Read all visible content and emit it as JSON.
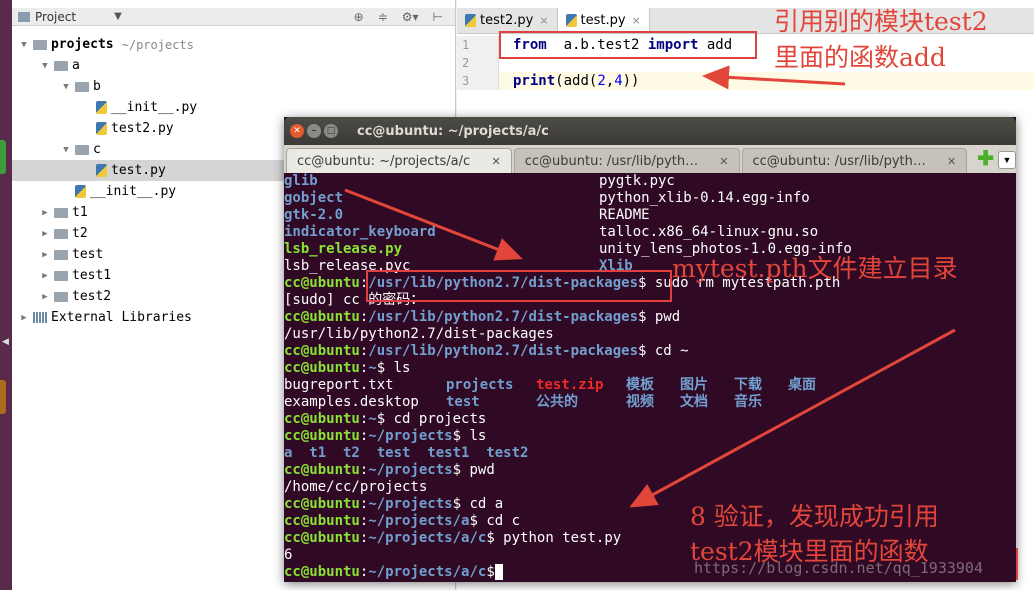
{
  "launcher": {},
  "project_panel": {
    "header": {
      "title": "Project",
      "tool_icons": [
        "crosshair-icon",
        "collapse-icon",
        "gear-icon",
        "hide-icon"
      ]
    },
    "tree": [
      {
        "label": "projects",
        "path": "~/projects",
        "depth": 0,
        "type": "folder",
        "expanded": true,
        "bold": true
      },
      {
        "label": "a",
        "depth": 1,
        "type": "folder",
        "expanded": true
      },
      {
        "label": "b",
        "depth": 2,
        "type": "folder",
        "expanded": true
      },
      {
        "label": "__init__.py",
        "depth": 3,
        "type": "py"
      },
      {
        "label": "test2.py",
        "depth": 3,
        "type": "py"
      },
      {
        "label": "c",
        "depth": 2,
        "type": "folder",
        "expanded": true
      },
      {
        "label": "test.py",
        "depth": 3,
        "type": "py",
        "selected": true
      },
      {
        "label": "__init__.py",
        "depth": 2,
        "type": "py"
      },
      {
        "label": "t1",
        "depth": 1,
        "type": "folder",
        "expanded": false
      },
      {
        "label": "t2",
        "depth": 1,
        "type": "folder",
        "expanded": false
      },
      {
        "label": "test",
        "depth": 1,
        "type": "folder",
        "expanded": false
      },
      {
        "label": "test1",
        "depth": 1,
        "type": "folder",
        "expanded": false
      },
      {
        "label": "test2",
        "depth": 1,
        "type": "folder",
        "expanded": false
      },
      {
        "label": "External Libraries",
        "depth": 0,
        "type": "lib",
        "expanded": false
      }
    ]
  },
  "editor": {
    "tabs": [
      {
        "label": "test2.py",
        "active": false
      },
      {
        "label": "test.py",
        "active": true
      }
    ],
    "lines": [
      {
        "no": "1",
        "parts": [
          [
            "kw",
            "from"
          ],
          [
            "",
            "  a.b.test2 "
          ],
          [
            "kw",
            "import"
          ],
          [
            "",
            " add"
          ]
        ]
      },
      {
        "no": "2",
        "parts": []
      },
      {
        "no": "3",
        "parts": [
          [
            "kw",
            "print"
          ],
          [
            "",
            "(add("
          ],
          [
            "num",
            "2"
          ],
          [
            "",
            ","
          ],
          [
            "num",
            "4"
          ],
          [
            "",
            "))"
          ]
        ]
      }
    ]
  },
  "annotations": {
    "top_line1": "引用别的模块test2",
    "top_line2": "里面的函数add",
    "mid": "mytest.pth文件建立目录",
    "bottom_line1": "8 验证，发现成功引用",
    "bottom_line2": "test2模块里面的函数"
  },
  "terminal": {
    "title": "cc@ubuntu: ~/projects/a/c",
    "tabs": [
      {
        "label": "cc@ubuntu: ~/projects/a/c",
        "active": true
      },
      {
        "label": "cc@ubuntu: /usr/lib/pyth…",
        "active": false
      },
      {
        "label": "cc@ubuntu: /usr/lib/pyth…",
        "active": false
      }
    ],
    "listing": [
      [
        [
          "dir",
          "glib"
        ],
        [
          "",
          "pygtk.pyc"
        ]
      ],
      [
        [
          "dir",
          "gobject"
        ],
        [
          "",
          "python_xlib-0.14.egg-info"
        ]
      ],
      [
        [
          "dir",
          "gtk-2.0"
        ],
        [
          "",
          "README"
        ]
      ],
      [
        [
          "dir",
          "indicator_keyboard"
        ],
        [
          "",
          "talloc.x86_64-linux-gnu.so"
        ]
      ],
      [
        [
          "exe",
          "lsb_release.py"
        ],
        [
          "",
          "unity_lens_photos-1.0.egg-info"
        ]
      ],
      [
        [
          "",
          "lsb_release.pyc"
        ],
        [
          "dir",
          "Xlib"
        ]
      ]
    ],
    "session": [
      {
        "user": "cc@ubuntu",
        "path": "/usr/lib/python2.7/dist-packages",
        "cmd": " sudo rm mytestpath.pth"
      },
      {
        "text": "[sudo] cc 的密码："
      },
      {
        "user": "cc@ubuntu",
        "path": "/usr/lib/python2.7/dist-packages",
        "cmd": " pwd"
      },
      {
        "text": "/usr/lib/python2.7/dist-packages"
      },
      {
        "user": "cc@ubuntu",
        "path": "/usr/lib/python2.7/dist-packages",
        "cmd": " cd ~"
      },
      {
        "user": "cc@ubuntu",
        "path": "~",
        "cmd": " ls"
      }
    ],
    "ls_home": [
      [
        [
          "",
          "bugreport.txt",
          0
        ],
        [
          "dir",
          "projects",
          162
        ],
        [
          "zip",
          "test.zip",
          252
        ],
        [
          "dir",
          "模板",
          342
        ],
        [
          "dir",
          "图片",
          396
        ],
        [
          "dir",
          "下载",
          450
        ],
        [
          "dir",
          "桌面",
          504
        ]
      ],
      [
        [
          "",
          "examples.desktop",
          0
        ],
        [
          "dir",
          "test",
          162
        ],
        [
          "dir",
          "公共的",
          252
        ],
        [
          "dir",
          "视频",
          342
        ],
        [
          "dir",
          "文档",
          396
        ],
        [
          "dir",
          "音乐",
          450
        ]
      ]
    ],
    "session2": [
      {
        "user": "cc@ubuntu",
        "path": "~",
        "cmd": " cd projects"
      },
      {
        "user": "cc@ubuntu",
        "path": "~/projects",
        "cmd": " ls"
      }
    ],
    "ls_projects": "a  t1  t2  test  test1  test2",
    "session3": [
      {
        "user": "cc@ubuntu",
        "path": "~/projects",
        "cmd": " pwd"
      },
      {
        "text": "/home/cc/projects"
      },
      {
        "user": "cc@ubuntu",
        "path": "~/projects",
        "cmd": " cd a"
      },
      {
        "user": "cc@ubuntu",
        "path": "~/projects/a",
        "cmd": " cd c"
      },
      {
        "user": "cc@ubuntu",
        "path": "~/projects/a/c",
        "cmd": " python test.py"
      },
      {
        "text": "6"
      },
      {
        "user": "cc@ubuntu",
        "path": "~/projects/a/c",
        "cmd": ""
      }
    ]
  },
  "watermark": "https://blog.csdn.net/qq_1933904",
  "colors": {
    "annotation_red": "#e2463a",
    "terminal_bg": "#300a24",
    "prompt_user": "#8ae234",
    "prompt_path": "#729fcf"
  }
}
